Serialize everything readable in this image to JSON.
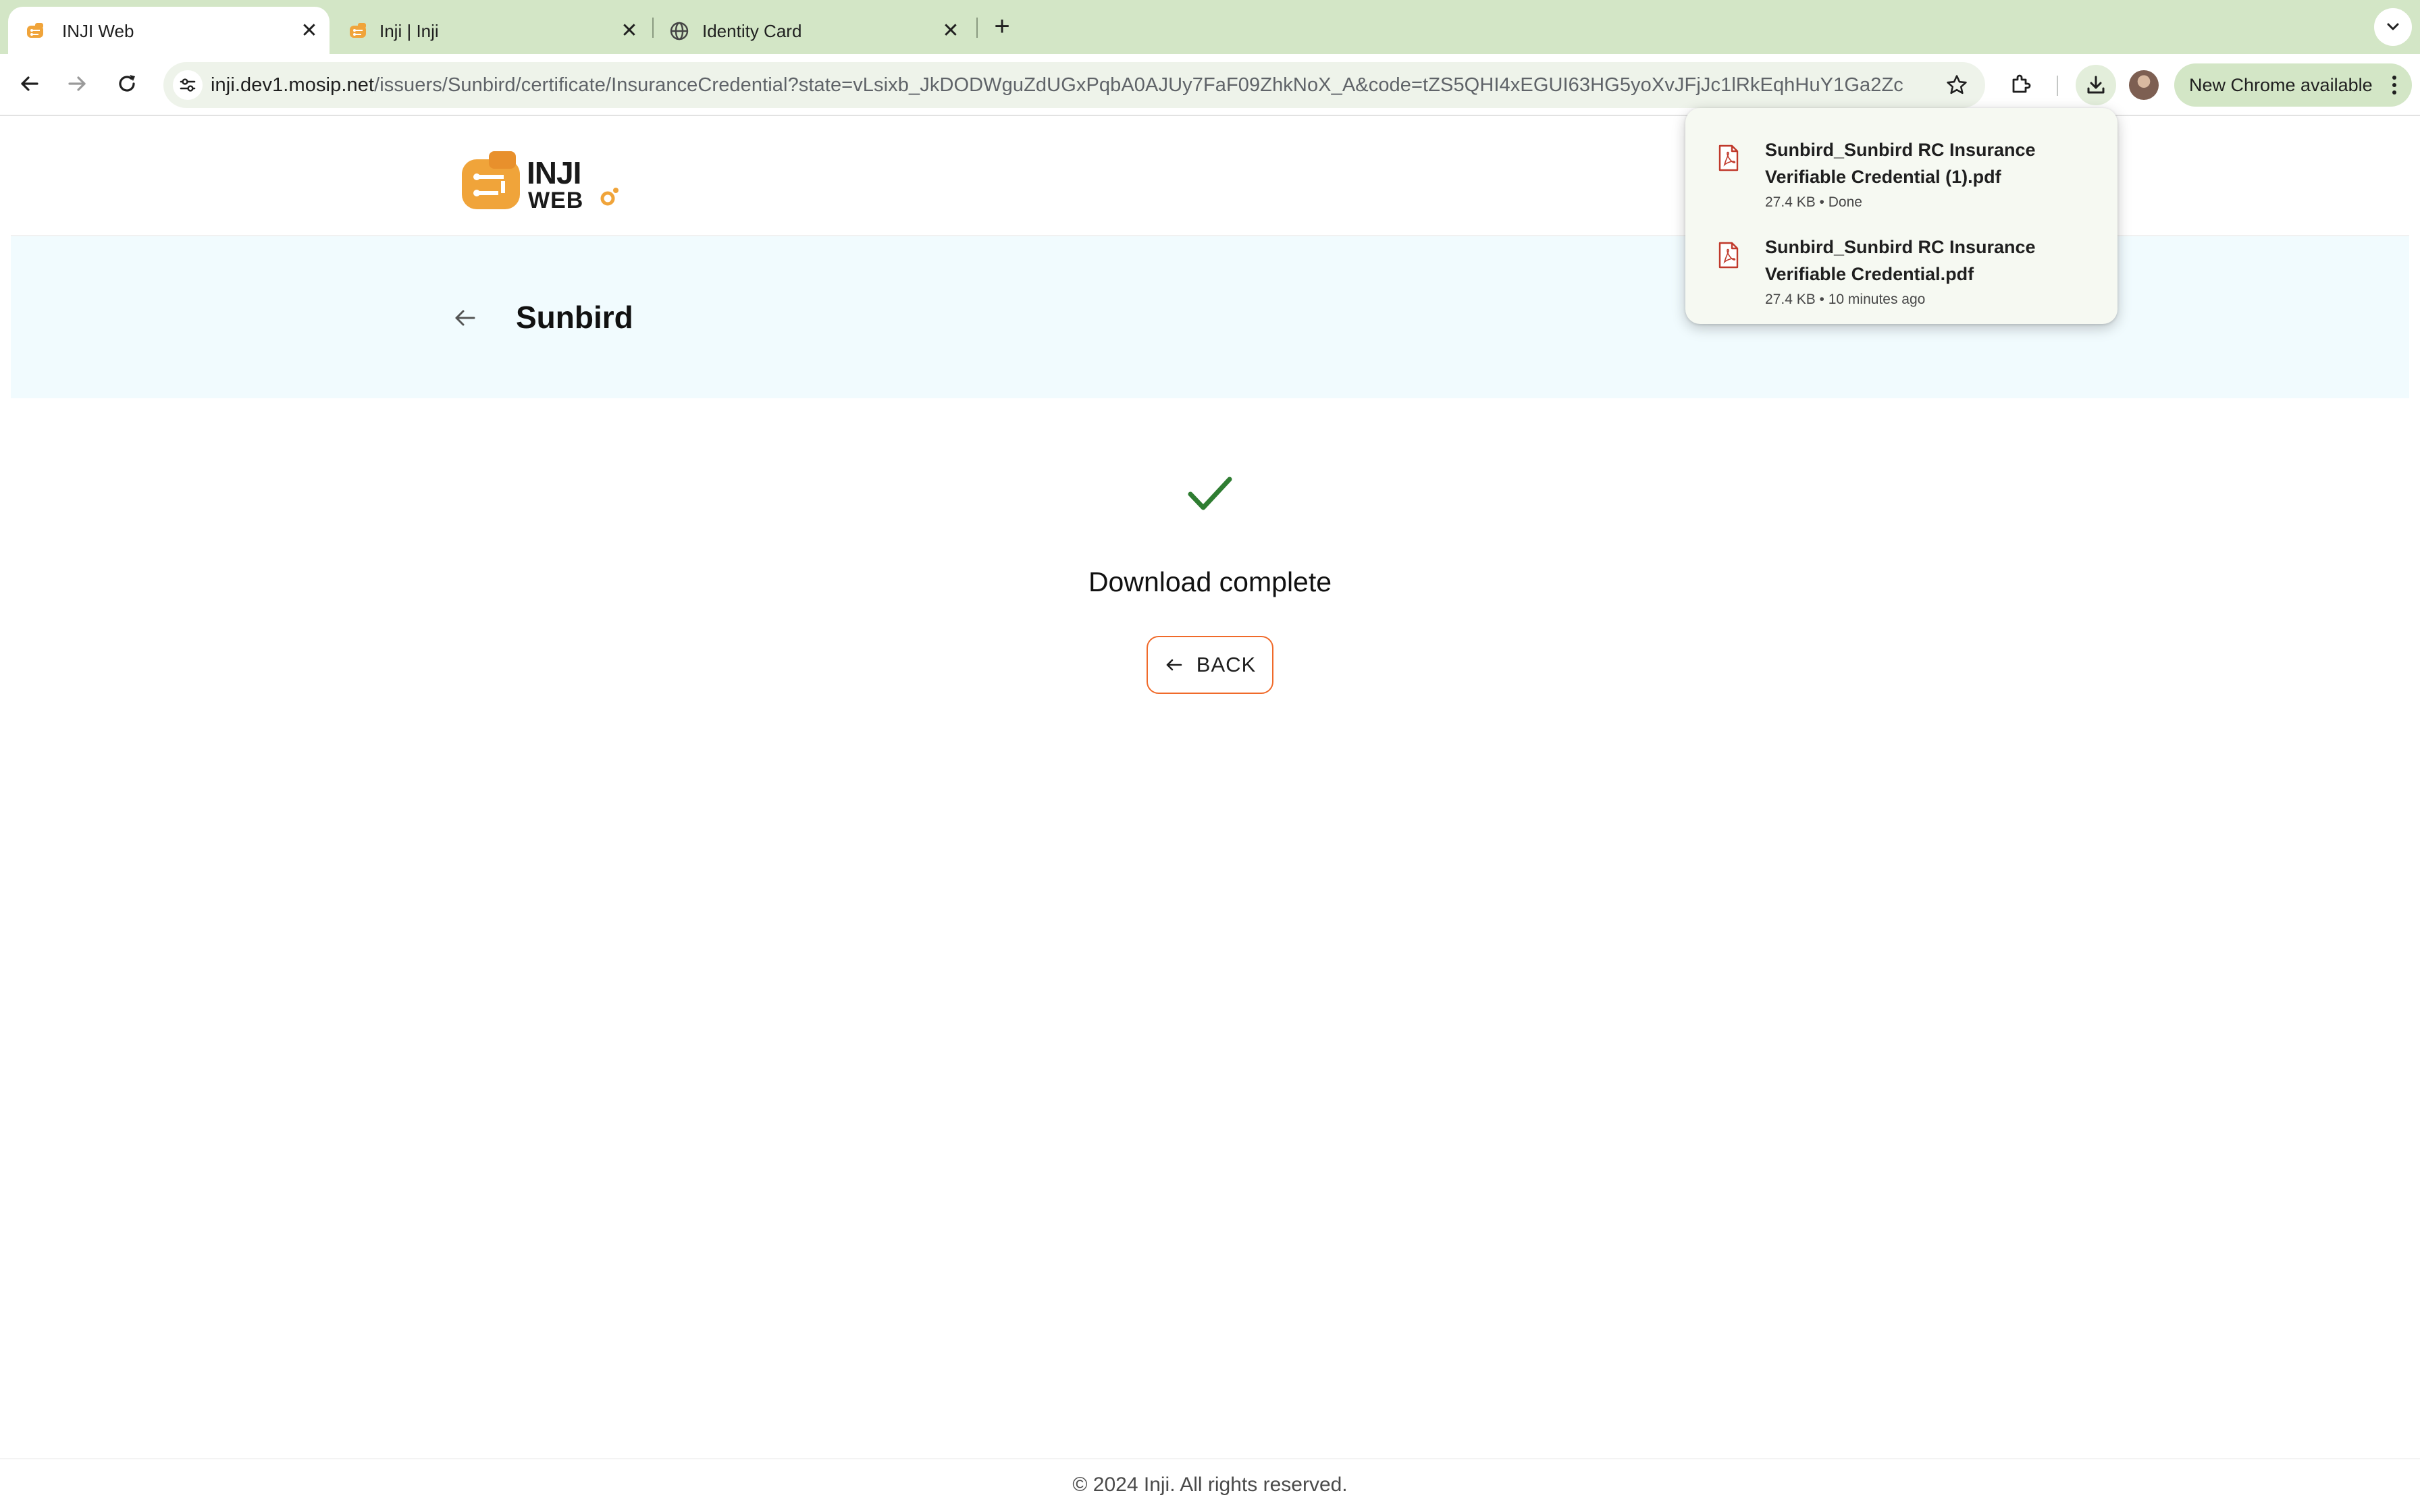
{
  "browser": {
    "tabs": [
      {
        "title": "INJI Web",
        "active": true,
        "favicon": "inji-logo-icon"
      },
      {
        "title": "Inji | Inji",
        "active": false,
        "favicon": "inji-logo-icon"
      },
      {
        "title": "Identity Card",
        "active": false,
        "favicon": "globe-icon"
      }
    ],
    "url_host": "inji.dev1.mosip.net",
    "url_path": "/issuers/Sunbird/certificate/InsuranceCredential?state=vLsixb_JkDODWguZdUGxPqbA0AJUy7FaF09ZhkNoX_A&code=tZS5QHI4xEGUI63HG5yoXvJFjJc1lRkEqhHuY1Ga2Zc",
    "update_label": "New Chrome available",
    "colors": {
      "frame": "#d3e6c6",
      "omnibox": "#eef3ea"
    }
  },
  "downloads": {
    "items": [
      {
        "name": "Sunbird_Sunbird RC Insurance Verifiable Credential (1).pdf",
        "meta": "27.4 KB • Done"
      },
      {
        "name": "Sunbird_Sunbird RC Insurance Verifiable Credential.pdf",
        "meta": "27.4 KB • 10 minutes ago"
      }
    ]
  },
  "page": {
    "logo_alt": "INJI WEB",
    "issuer_title": "Sunbird",
    "status_message": "Download complete",
    "back_button_label": "BACK",
    "footer_text": "© 2024 Inji. All rights reserved.",
    "colors": {
      "accent": "#f06a2a",
      "success": "#2f7d32",
      "hero_bg": "#f1fbfe",
      "logo_orange": "#f0a43a"
    }
  }
}
